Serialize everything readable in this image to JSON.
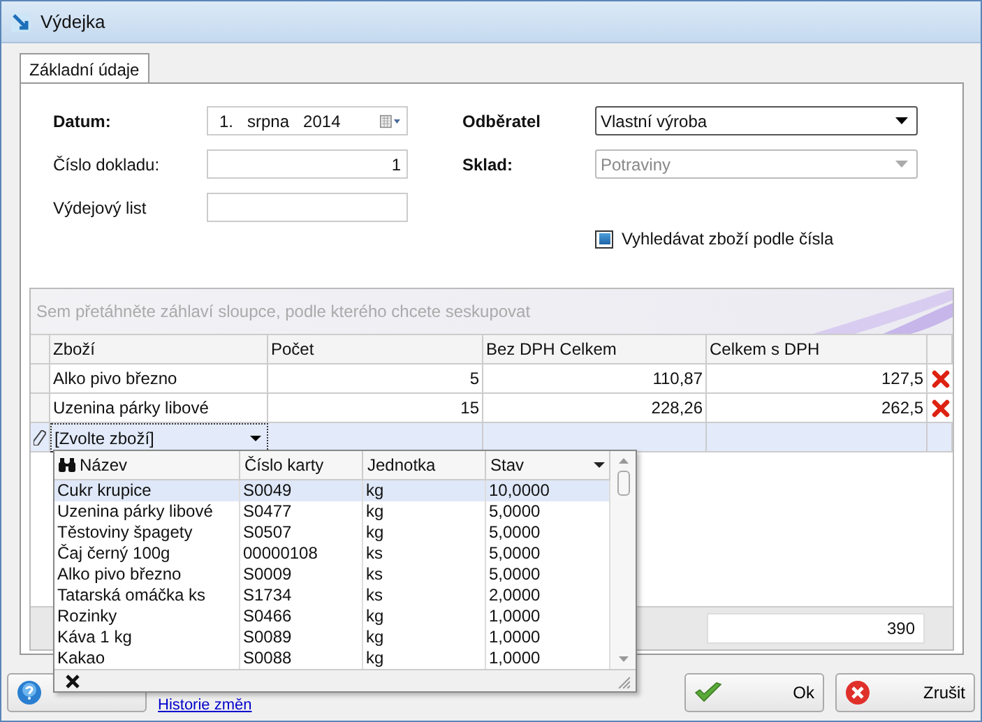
{
  "window": {
    "title": "Výdejka"
  },
  "tabs": [
    {
      "label": "Základní údaje",
      "selected": true
    }
  ],
  "form": {
    "left": [
      {
        "kind": "date",
        "label": "Datum:",
        "bold": true,
        "day": "1.",
        "month": "srpna",
        "year": "2014"
      },
      {
        "kind": "text",
        "label": "Číslo dokladu:",
        "bold": false,
        "value": "1"
      },
      {
        "kind": "text",
        "label": "Výdejový list",
        "bold": false
      }
    ],
    "right": [
      {
        "kind": "combo",
        "label": "Odběratel",
        "bold": true,
        "value": "Vlastní výroba",
        "disabled": false
      },
      {
        "kind": "combo",
        "label": "Sklad:",
        "bold": true,
        "value": "Potraviny",
        "disabled": true
      }
    ],
    "search_by_number": {
      "label": "Vyhledávat zboží podle čísla",
      "checked": true
    }
  },
  "grid": {
    "group_hint": "Sem přetáhněte záhlaví sloupce, podle kterého chcete seskupovat",
    "columns": [
      "Zboží",
      "Počet",
      "Bez DPH Celkem",
      "Celkem s DPH"
    ],
    "rows": [
      {
        "cells": [
          "Alko pivo březno",
          "5",
          "110,87",
          "127,5"
        ]
      },
      {
        "cells": [
          "Uzenina párky libové",
          "15",
          "228,26",
          "262,5"
        ]
      }
    ],
    "new_row": {
      "value": "[Zvolte zboží]"
    },
    "total": "390"
  },
  "dropdown": {
    "columns": [
      {
        "label": "Název",
        "kind": "search"
      },
      {
        "label": "Číslo karty",
        "kind": "plain"
      },
      {
        "label": "Jednotka",
        "kind": "plain"
      },
      {
        "label": "Stav",
        "kind": "sort"
      }
    ],
    "rows": [
      {
        "cells": [
          "Cukr krupice",
          "S0049",
          "kg",
          "10,0000"
        ],
        "selected": true
      },
      {
        "cells": [
          "Uzenina párky libové",
          "S0477",
          "kg",
          "5,0000"
        ],
        "selected": false
      },
      {
        "cells": [
          "Těstoviny špagety",
          "S0507",
          "kg",
          "5,0000"
        ],
        "selected": false
      },
      {
        "cells": [
          "Čaj černý 100g",
          "00000108",
          "ks",
          "5,0000"
        ],
        "selected": false
      },
      {
        "cells": [
          "Alko pivo březno",
          "S0009",
          "ks",
          "5,0000"
        ],
        "selected": false
      },
      {
        "cells": [
          "Tatarská omáčka ks",
          "S1734",
          "ks",
          "2,0000"
        ],
        "selected": false
      },
      {
        "cells": [
          "Rozinky",
          "S0466",
          "kg",
          "1,0000"
        ],
        "selected": false
      },
      {
        "cells": [
          "Káva 1 kg",
          "S0089",
          "kg",
          "1,0000"
        ],
        "selected": false
      },
      {
        "cells": [
          "Kakao",
          "S0088",
          "kg",
          "1,0000"
        ],
        "selected": false
      }
    ]
  },
  "footer": {
    "link": "Historie změn",
    "buttons": [
      {
        "kind": "ok",
        "label": "Ok"
      },
      {
        "kind": "cancel",
        "label": "Zrušit"
      }
    ]
  }
}
